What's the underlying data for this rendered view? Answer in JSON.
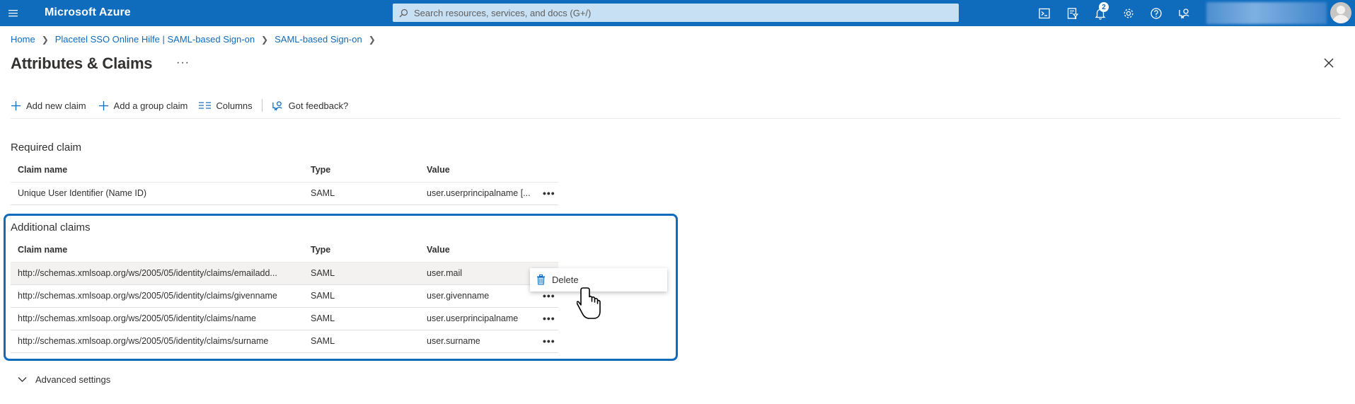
{
  "topbar": {
    "brand": "Microsoft Azure",
    "search_placeholder": "Search resources, services, and docs (G+/)",
    "notification_count": "2",
    "icons": [
      "cloud-shell-icon",
      "directory-filter-icon",
      "bell-icon",
      "gear-icon",
      "help-icon",
      "feedback-icon"
    ]
  },
  "breadcrumb": {
    "items": [
      "Home",
      "Placetel SSO Online Hilfe | SAML-based Sign-on",
      "SAML-based Sign-on"
    ]
  },
  "page": {
    "title": "Attributes & Claims",
    "more": "···"
  },
  "toolbar": {
    "add_new_claim": "Add new claim",
    "add_group_claim": "Add a group claim",
    "columns": "Columns",
    "feedback": "Got feedback?"
  },
  "required": {
    "title": "Required claim",
    "headers": [
      "Claim name",
      "Type",
      "Value"
    ],
    "rows": [
      [
        "Unique User Identifier (Name ID)",
        "SAML",
        "user.userprincipalname [..."
      ]
    ]
  },
  "additional": {
    "title": "Additional claims",
    "headers": [
      "Claim name",
      "Type",
      "Value"
    ],
    "rows": [
      [
        "http://schemas.xmlsoap.org/ws/2005/05/identity/claims/emailadd...",
        "SAML",
        "user.mail"
      ],
      [
        "http://schemas.xmlsoap.org/ws/2005/05/identity/claims/givenname",
        "SAML",
        "user.givenname"
      ],
      [
        "http://schemas.xmlsoap.org/ws/2005/05/identity/claims/name",
        "SAML",
        "user.userprincipalname"
      ],
      [
        "http://schemas.xmlsoap.org/ws/2005/05/identity/claims/surname",
        "SAML",
        "user.surname"
      ]
    ],
    "row_more": "•••"
  },
  "context_menu": {
    "delete_label": "Delete"
  },
  "advanced": {
    "label": "Advanced settings"
  },
  "colors": {
    "azure_blue": "#0f6cbd",
    "search_bg": "#c7e0f4",
    "highlight_row": "#f3f2f1"
  }
}
